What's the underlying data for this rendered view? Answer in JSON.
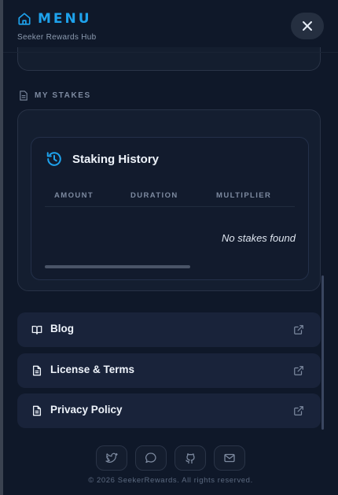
{
  "header": {
    "title": "MENU",
    "subtitle": "Seeker Rewards Hub",
    "home_icon": "home-icon",
    "close_icon": "close-icon",
    "accent_color": "#1ea2ec"
  },
  "my_stakes": {
    "section_label": "MY STAKES",
    "section_icon": "document-icon",
    "history": {
      "icon": "history-icon",
      "title": "Staking History",
      "columns": [
        "AMOUNT",
        "DURATION",
        "MULTIPLIER"
      ],
      "empty_message": "No stakes found"
    }
  },
  "links": [
    {
      "label": "Blog",
      "icon": "book-icon",
      "trailing_icon": "external-link-icon"
    },
    {
      "label": "License & Terms",
      "icon": "document-icon",
      "trailing_icon": "external-link-icon"
    },
    {
      "label": "Privacy Policy",
      "icon": "document-icon",
      "trailing_icon": "external-link-icon"
    }
  ],
  "socials": [
    {
      "icon": "twitter-icon"
    },
    {
      "icon": "chat-icon"
    },
    {
      "icon": "github-icon"
    },
    {
      "icon": "mail-icon"
    }
  ],
  "footer": {
    "copyright": "© 2026 SeekerRewards. All rights reserved."
  }
}
